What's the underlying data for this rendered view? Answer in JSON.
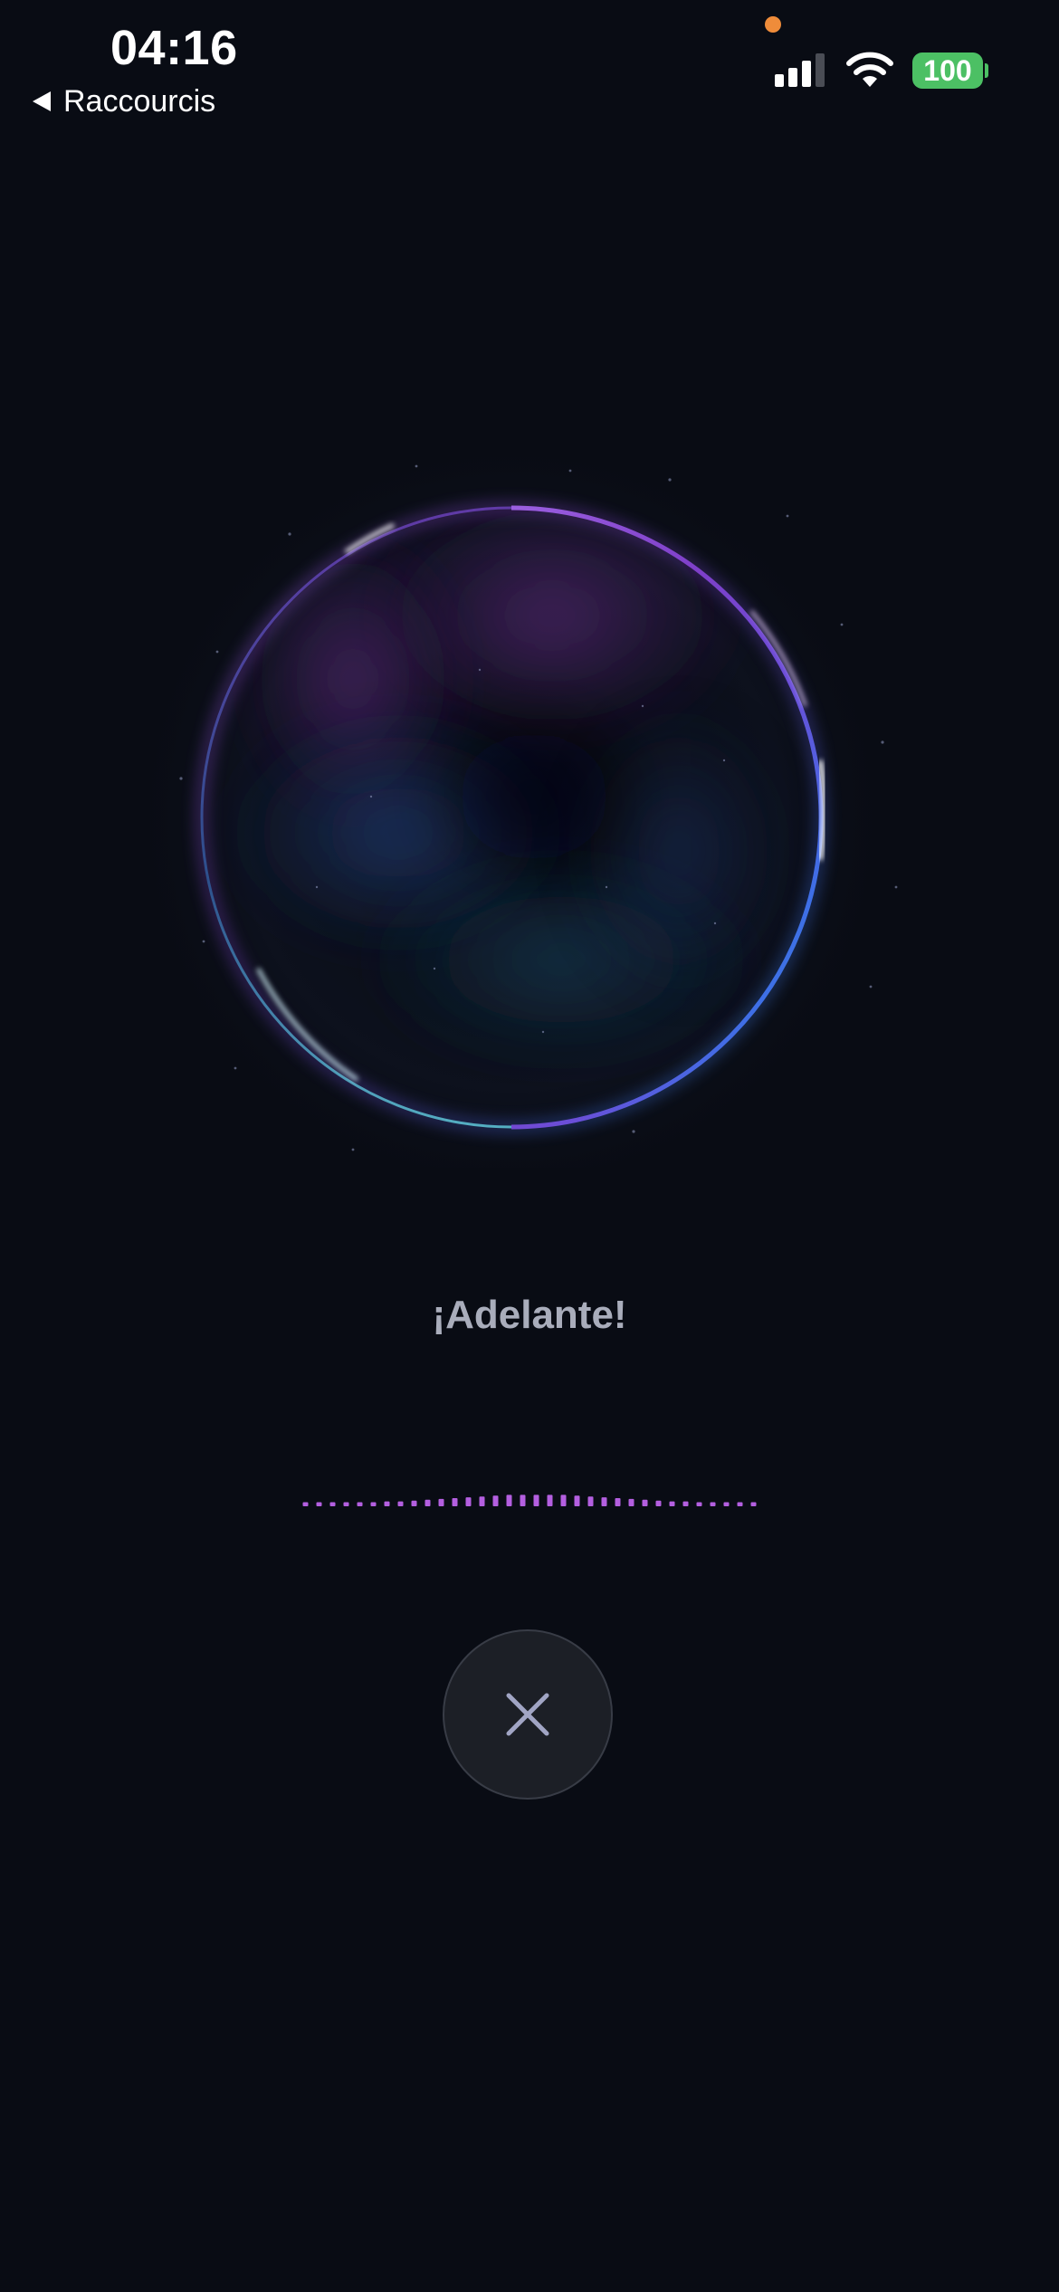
{
  "status_bar": {
    "time": "04:16",
    "back_label": "Raccourcis",
    "battery": "100",
    "signal_bars_filled": 3,
    "signal_bars_total": 4
  },
  "main": {
    "prompt": "¡Adelante!"
  },
  "icons": {
    "back": "back-triangle-icon",
    "signal": "cellular-signal-icon",
    "wifi": "wifi-icon",
    "battery": "battery-icon",
    "close": "close-icon",
    "privacy": "microphone-in-use-indicator"
  },
  "colors": {
    "background": "#090c14",
    "accent_wave": "#b45fe0",
    "battery_green": "#4cc064",
    "privacy_orange": "#ef8c3a",
    "text_muted": "#a9adbb",
    "close_icon": "#a1a5c4"
  },
  "waveform_levels": [
    0.25,
    0.25,
    0.25,
    0.25,
    0.25,
    0.25,
    0.3,
    0.3,
    0.35,
    0.4,
    0.45,
    0.5,
    0.55,
    0.6,
    0.65,
    0.7,
    0.7,
    0.7,
    0.7,
    0.7,
    0.65,
    0.6,
    0.55,
    0.5,
    0.45,
    0.4,
    0.35,
    0.3,
    0.3,
    0.25,
    0.25,
    0.25,
    0.25,
    0.25
  ]
}
